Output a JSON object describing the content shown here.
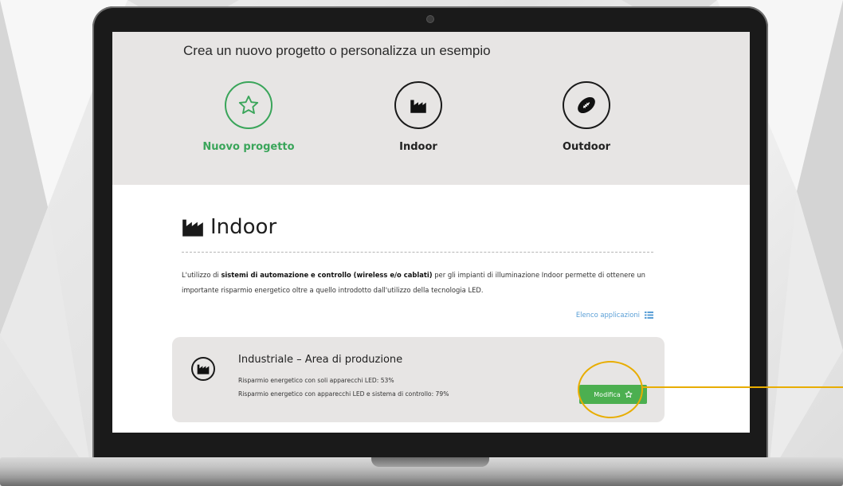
{
  "hero": {
    "title": "Crea un nuovo progetto o personalizza un esempio",
    "options": [
      {
        "label": "Nuovo progetto",
        "icon": "star-icon",
        "color": "#3aa55a"
      },
      {
        "label": "Indoor",
        "icon": "factory-icon"
      },
      {
        "label": "Outdoor",
        "icon": "football-icon"
      }
    ]
  },
  "section": {
    "title": "Indoor",
    "icon": "factory-icon",
    "description_pre": "L'utilizzo di ",
    "description_bold": "sistemi di automazione e controllo (wireless e/o cablati)",
    "description_post": " per gli impianti di illuminazione Indoor permette di ottenere un importante risparmio energetico oltre a quello introdotto dall'utilizzo della tecnologia LED.",
    "app_list_link": "Elenco applicazioni"
  },
  "card": {
    "title": "Industriale – Area di produzione",
    "line1": "Risparmio energetico con soli apparecchi LED: 53%",
    "line2": "Risparmio energetico con apparecchi LED e sistema di controllo: 79%",
    "button_label": "Modifica"
  },
  "colors": {
    "accent_green": "#3aa55a",
    "button_green": "#4caf50",
    "link_blue": "#5a9fd6",
    "highlight": "#e8ad00"
  }
}
